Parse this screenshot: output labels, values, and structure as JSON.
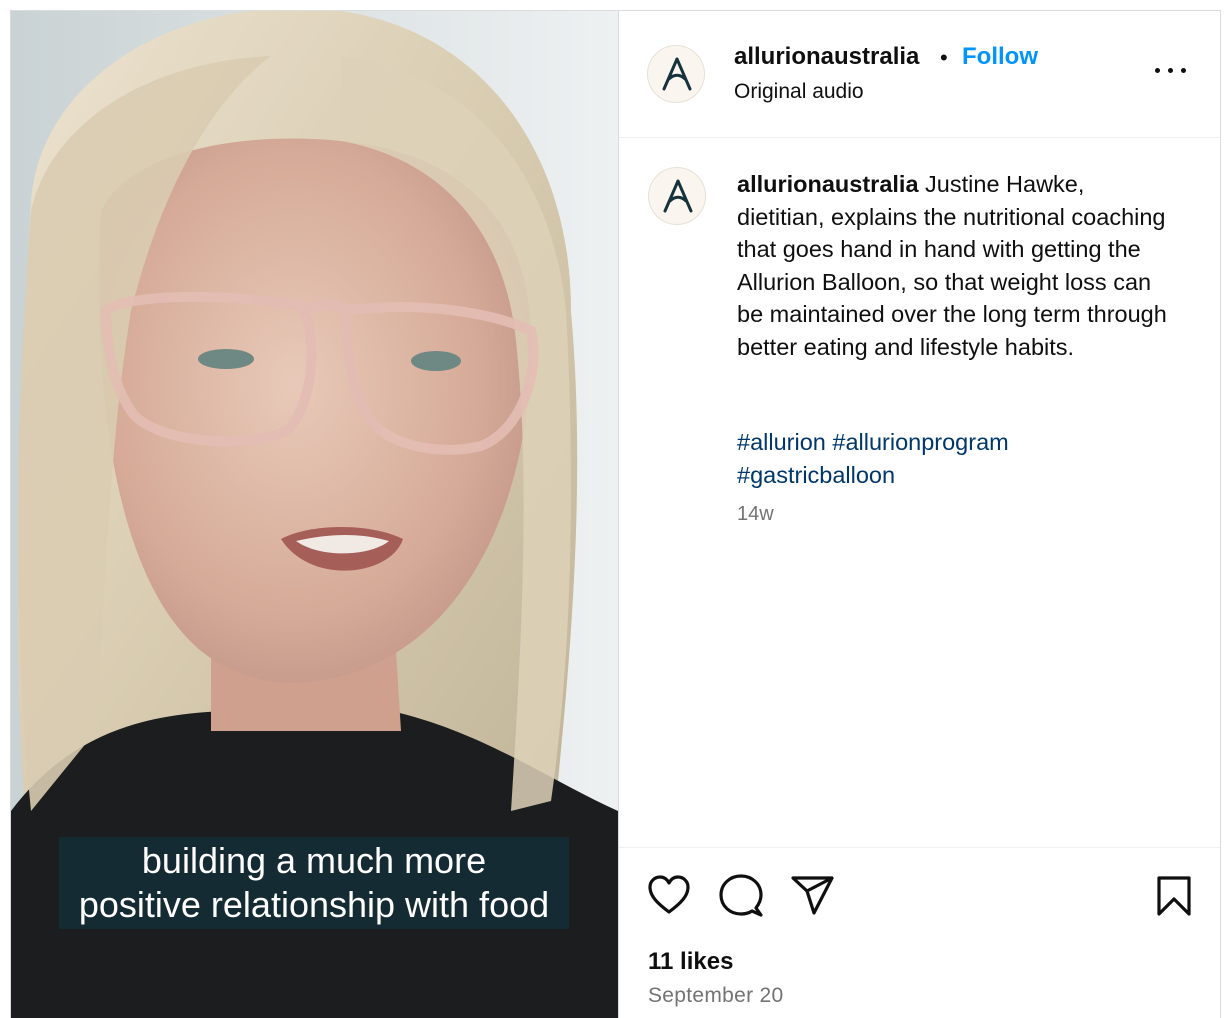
{
  "video": {
    "caption_line1": "building a much more",
    "caption_line2": "positive relationship with food"
  },
  "header": {
    "username": "allurionaustralia",
    "separator": "•",
    "follow_label": "Follow",
    "audio": "Original audio",
    "more_icon": "more-horizontal-icon"
  },
  "post": {
    "username": "allurionaustralia",
    "text": " Justine Hawke, dietitian, explains the nutritional coaching that goes hand in hand with getting the Allurion Balloon, so that weight loss can be maintained over the long term through better eating and lifestyle habits.",
    "hashtags": [
      "#allurion",
      "#allurionprogram",
      "#gastricballoon"
    ],
    "age": "14w"
  },
  "actions": {
    "like_icon": "heart-icon",
    "comment_icon": "comment-icon",
    "share_icon": "share-icon",
    "save_icon": "bookmark-icon"
  },
  "stats": {
    "likes": "11 likes",
    "date": "September 20"
  },
  "colors": {
    "follow": "#0095f6",
    "hashtag": "#00376b",
    "muted": "#737373",
    "logo": "#16323c"
  }
}
